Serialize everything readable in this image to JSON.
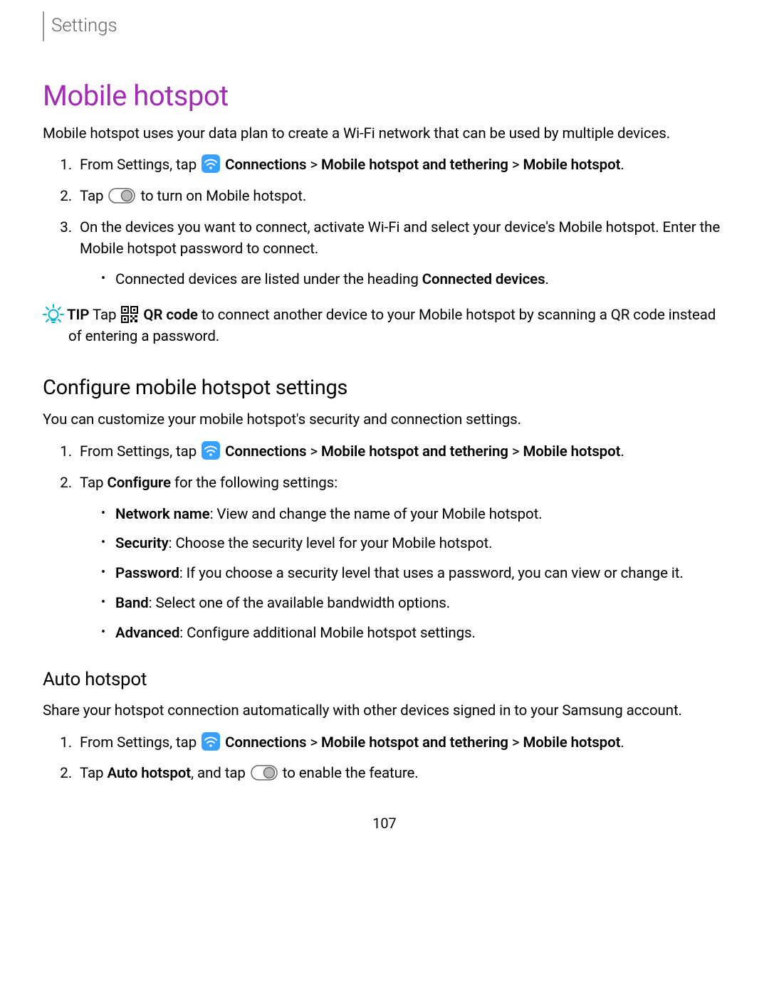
{
  "breadcrumb": "Settings",
  "page_number": "107",
  "colors": {
    "heading": "#a32cb4",
    "tip_icon": "#00b3d4",
    "conn_icon_bg": "#38a0ff"
  },
  "section": {
    "title": "Mobile hotspot",
    "intro": "Mobile hotspot uses your data plan to create a Wi-Fi network that can be used by multiple devices.",
    "steps": {
      "s1_pre": "From Settings, tap ",
      "s1_conn": "Connections",
      "s1_sep1": " > ",
      "s1_mht": "Mobile hotspot and tethering",
      "s1_sep2": " > ",
      "s1_mh": "Mobile hotspot",
      "s1_end": ".",
      "s2_pre": "Tap ",
      "s2_post": " to turn on Mobile hotspot.",
      "s3_text": "On the devices you want to connect, activate Wi-Fi and select your device's Mobile hotspot. Enter the Mobile hotspot password to connect.",
      "s3_bullet_pre": "Connected devices are listed under the heading ",
      "s3_bullet_bold": "Connected devices",
      "s3_bullet_end": "."
    },
    "tip": {
      "label": "TIP",
      "pre": "  Tap ",
      "qr_bold": "QR code",
      "post": " to connect another device to your Mobile hotspot by scanning a QR code instead of entering a password."
    },
    "configure": {
      "title": "Configure mobile hotspot settings",
      "intro": "You can customize your mobile hotspot's security and connection settings.",
      "s1_pre": "From Settings, tap ",
      "s1_conn": "Connections",
      "s1_sep1": " > ",
      "s1_mht": "Mobile hotspot and tethering",
      "s1_sep2": " > ",
      "s1_mh": "Mobile hotspot",
      "s1_end": ".",
      "s2_pre": "Tap ",
      "s2_bold": "Configure",
      "s2_post": " for the following settings:",
      "opts": {
        "net_label": "Network name",
        "net_text": ": View and change the name of your Mobile hotspot.",
        "sec_label": "Security",
        "sec_text": ": Choose the security level for your Mobile hotspot.",
        "pwd_label": "Password",
        "pwd_text": ": If you choose a security level that uses a password, you can view or change it.",
        "band_label": "Band",
        "band_text": ": Select one of the available bandwidth options.",
        "adv_label": "Advanced",
        "adv_text": ": Configure additional Mobile hotspot settings."
      }
    },
    "auto": {
      "title": "Auto hotspot",
      "intro": "Share your hotspot connection automatically with other devices signed in to your Samsung account.",
      "s1_pre": "From Settings, tap ",
      "s1_conn": "Connections",
      "s1_sep1": " > ",
      "s1_mht": "Mobile hotspot and tethering",
      "s1_sep2": " > ",
      "s1_mh": "Mobile hotspot",
      "s1_end": ".",
      "s2_pre": "Tap ",
      "s2_bold": "Auto hotspot",
      "s2_mid": ", and tap ",
      "s2_post": " to enable the feature."
    }
  }
}
